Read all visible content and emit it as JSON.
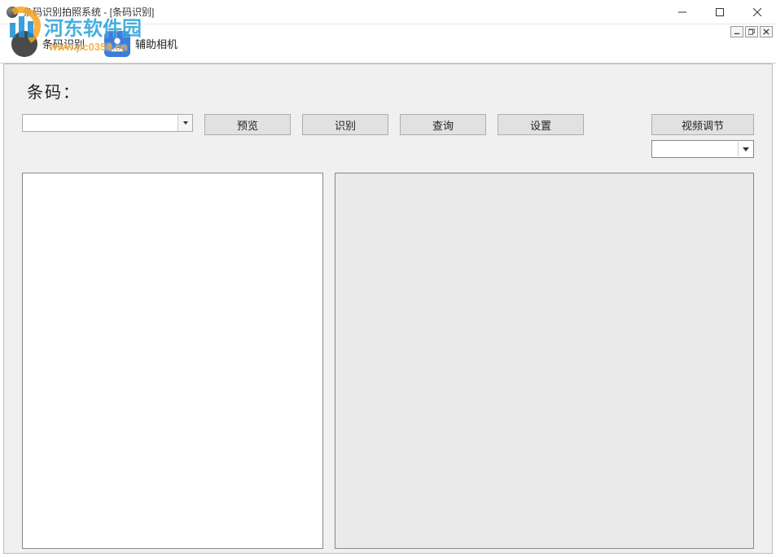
{
  "window": {
    "title": "条码识别拍照系统 - [条码识别]"
  },
  "toolbar": {
    "barcode_recognition": "条码识别",
    "aux_camera": "辅助相机"
  },
  "main": {
    "barcode_label": "条码：",
    "combo_value": "",
    "buttons": {
      "preview": "预览",
      "recognize": "识别",
      "query": "查询",
      "settings": "设置",
      "video_adjust": "视频调节"
    },
    "video_select_value": ""
  },
  "watermark": {
    "site_name": "河东软件园",
    "url": "www.pc0359.cn"
  }
}
